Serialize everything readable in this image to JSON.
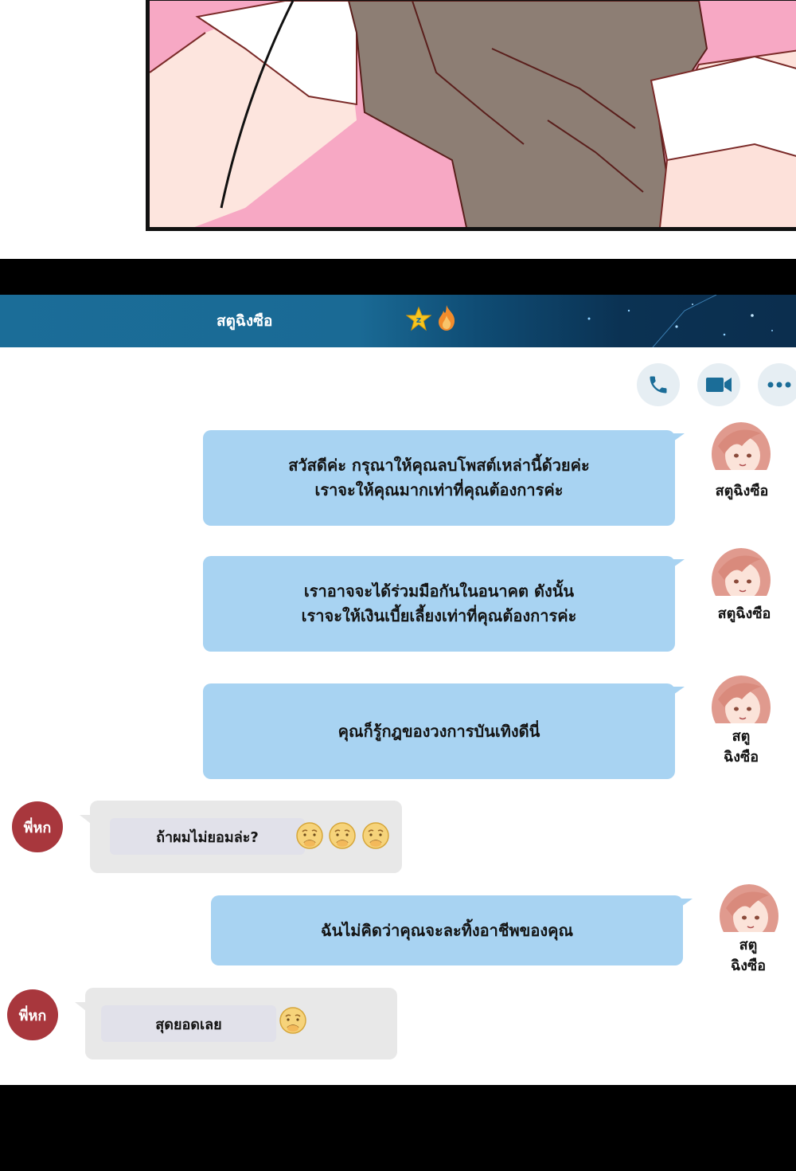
{
  "header": {
    "title": "สตูฉิงซือ"
  },
  "actions": {
    "call": "phone-icon",
    "video": "video-icon",
    "more": "more-icon"
  },
  "messages": [
    {
      "side": "right",
      "lines": [
        "สวัสดีค่ะ กรุณาให้คุณลบโพสต์เหล่านี้ด้วยค่ะ",
        "เราจะให้คุณมากเท่าที่คุณต้องการค่ะ"
      ],
      "sender": "สตูฉิงซือ"
    },
    {
      "side": "right",
      "lines": [
        "เราอาจจะได้ร่วมมือกันในอนาคต ดังนั้น",
        "เราจะให้เงินเบี้ยเลี้ยงเท่าที่คุณต้องการค่ะ"
      ],
      "sender": "สตูฉิงซือ"
    },
    {
      "side": "right",
      "lines": [
        "คุณก็รู้กฎของวงการบันเทิงดีนี่"
      ],
      "sender_lines": [
        "สตู",
        "ฉิงซือ"
      ]
    },
    {
      "side": "left",
      "avatar": "พี่หก",
      "text": "ถ้าผมไม่ยอมล่ะ?",
      "emoji": [
        "worried-emoji",
        "worried-emoji",
        "worried-emoji"
      ]
    },
    {
      "side": "right",
      "lines": [
        "ฉันไม่คิดว่าคุณจะละทิ้งอาชีพของคุณ"
      ],
      "sender_lines": [
        "สตู",
        "ฉิงซือ"
      ]
    },
    {
      "side": "left",
      "avatar": "พี่หก",
      "text": "สุดยอดเลย",
      "emoji": [
        "worried-emoji"
      ]
    }
  ],
  "colors": {
    "header": "#1b6d98",
    "bubble_blue": "#a8d3f2",
    "bubble_grey": "#e8e8e8",
    "red_avatar": "#a8373d"
  }
}
